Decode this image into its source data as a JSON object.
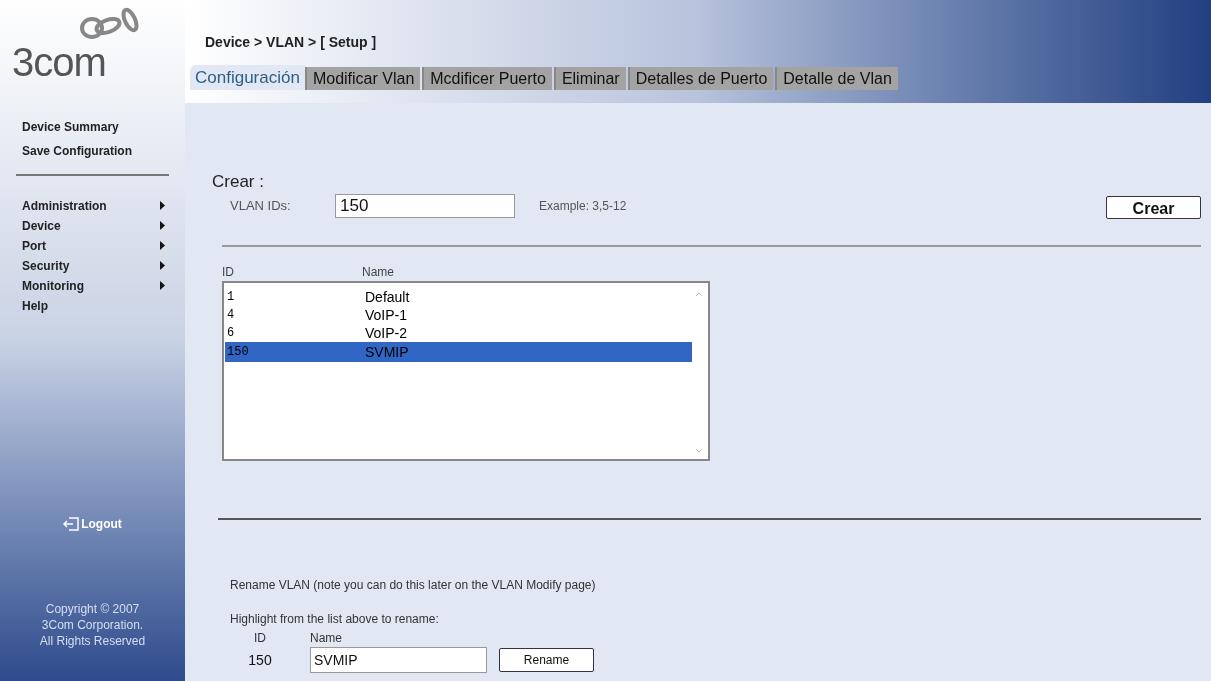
{
  "logo": {
    "text": "3com"
  },
  "sidebar": {
    "top_links": [
      "Device Summary",
      "Save Configuration"
    ],
    "menu": [
      {
        "label": "Administration",
        "has_submenu": true
      },
      {
        "label": "Device",
        "has_submenu": true
      },
      {
        "label": "Port",
        "has_submenu": true
      },
      {
        "label": "Security",
        "has_submenu": true
      },
      {
        "label": "Monitoring",
        "has_submenu": true
      },
      {
        "label": "Help",
        "has_submenu": false
      }
    ],
    "logout": "Logout",
    "copyright": [
      "Copyright © 2007",
      "3Com Corporation.",
      "All Rights Reserved"
    ]
  },
  "breadcrumb": "Device > VLAN > [ Setup ]",
  "tabs": [
    {
      "label": "Configuración",
      "selected": true
    },
    {
      "label": "Modificar Vlan",
      "selected": false
    },
    {
      "label": "Mcdificer Puerto",
      "selected": false
    },
    {
      "label": "Eliminar",
      "selected": false
    },
    {
      "label": "Detalles de Puerto",
      "selected": false
    },
    {
      "label": "Detalle de Vlan",
      "selected": false
    }
  ],
  "create": {
    "title": "Crear :",
    "field_label": "VLAN IDs:",
    "value": "150",
    "example": "Example: 3,5-12",
    "button": "Crear"
  },
  "vlan_list": {
    "columns": [
      "ID",
      "Name"
    ],
    "rows": [
      {
        "id": "1",
        "name": "Default",
        "selected": false
      },
      {
        "id": "4",
        "name": "VoIP-1",
        "selected": false
      },
      {
        "id": "6",
        "name": "VoIP-2",
        "selected": false
      },
      {
        "id": "150",
        "name": "SVMIP",
        "selected": true
      }
    ]
  },
  "rename": {
    "note": "Rename VLAN (note you can do this later on the VLAN Modify page)",
    "hint": "Highlight from the list above to rename:",
    "id_label": "ID",
    "name_label": "Name",
    "id_value": "150",
    "name_value": "SVMIP",
    "button": "Rename"
  }
}
